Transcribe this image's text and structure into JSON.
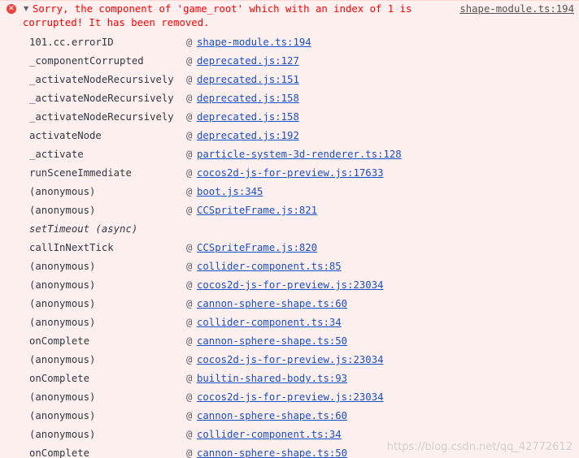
{
  "error": {
    "icon": "error-icon",
    "icon_glyph": "✕",
    "expand_glyph": "▼",
    "message_line1": "Sorry, the component of 'game_root' which with an index of 1 is",
    "message_line2": "corrupted! It has been removed.",
    "source": "shape-module.ts:194"
  },
  "stack": [
    {
      "fn": "101.cc.errorID",
      "at": "@",
      "loc": "shape-module.ts:194"
    },
    {
      "fn": "_componentCorrupted",
      "at": "@",
      "loc": "deprecated.js:127"
    },
    {
      "fn": "_activateNodeRecursively",
      "at": "@",
      "loc": "deprecated.js:151"
    },
    {
      "fn": "_activateNodeRecursively",
      "at": "@",
      "loc": "deprecated.js:158"
    },
    {
      "fn": "_activateNodeRecursively",
      "at": "@",
      "loc": "deprecated.js:158"
    },
    {
      "fn": "activateNode",
      "at": "@",
      "loc": "deprecated.js:192"
    },
    {
      "fn": "_activate",
      "at": "@",
      "loc": "particle-system-3d-renderer.ts:128"
    },
    {
      "fn": "runSceneImmediate",
      "at": "@",
      "loc": "cocos2d-js-for-preview.js:17633"
    },
    {
      "fn": "(anonymous)",
      "at": "@",
      "loc": "boot.js:345"
    },
    {
      "fn": "(anonymous)",
      "at": "@",
      "loc": "CCSpriteFrame.js:821"
    },
    {
      "fn": "setTimeout (async)",
      "at": "",
      "loc": "",
      "async": true
    },
    {
      "fn": "callInNextTick",
      "at": "@",
      "loc": "CCSpriteFrame.js:820"
    },
    {
      "fn": "(anonymous)",
      "at": "@",
      "loc": "collider-component.ts:85"
    },
    {
      "fn": "(anonymous)",
      "at": "@",
      "loc": "cocos2d-js-for-preview.js:23034"
    },
    {
      "fn": "(anonymous)",
      "at": "@",
      "loc": "cannon-sphere-shape.ts:60"
    },
    {
      "fn": "(anonymous)",
      "at": "@",
      "loc": "collider-component.ts:34"
    },
    {
      "fn": "onComplete",
      "at": "@",
      "loc": "cannon-sphere-shape.ts:50"
    },
    {
      "fn": "(anonymous)",
      "at": "@",
      "loc": "cocos2d-js-for-preview.js:23034"
    },
    {
      "fn": "onComplete",
      "at": "@",
      "loc": "builtin-shared-body.ts:93"
    },
    {
      "fn": "(anonymous)",
      "at": "@",
      "loc": "cocos2d-js-for-preview.js:23034"
    },
    {
      "fn": "(anonymous)",
      "at": "@",
      "loc": "cannon-sphere-shape.ts:60"
    },
    {
      "fn": "(anonymous)",
      "at": "@",
      "loc": "collider-component.ts:34"
    },
    {
      "fn": "onComplete",
      "at": "@",
      "loc": "cannon-sphere-shape.ts:50"
    }
  ],
  "watermark": "https://blog.csdn.net/qq_42772612",
  "colors": {
    "background": "#fff0f0",
    "error_text": "#ff0000",
    "link": "#1a4fc7"
  }
}
